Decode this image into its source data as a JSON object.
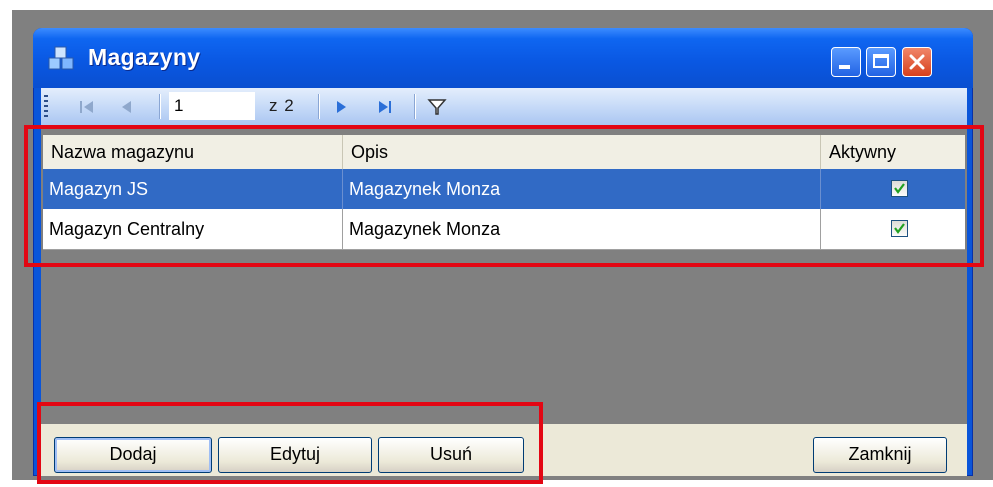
{
  "window": {
    "title": "Magazyny",
    "icon": "boxes-icon",
    "controls": [
      "minimize-icon",
      "maximize-icon",
      "close-icon"
    ]
  },
  "toolbar": {
    "current_page": "1",
    "page_of": "z 2",
    "icons": [
      "first-page-icon",
      "prev-page-icon",
      "next-page-icon",
      "last-page-icon",
      "filter-icon"
    ]
  },
  "grid": {
    "columns": [
      "Nazwa magazynu",
      "Opis",
      "Aktywny"
    ],
    "rows": [
      {
        "name": "Magazyn JS",
        "desc": "Magazynek Monza",
        "active": true,
        "selected": true
      },
      {
        "name": "Magazyn Centralny",
        "desc": "Magazynek Monza",
        "active": true,
        "selected": false
      }
    ]
  },
  "buttons": {
    "add": "Dodaj",
    "edit": "Edytuj",
    "delete": "Usuń",
    "close": "Zamknij"
  },
  "colors": {
    "selection": "#316ac5",
    "highlight_box": "#e30613",
    "titlebar": "#0a58e3"
  }
}
